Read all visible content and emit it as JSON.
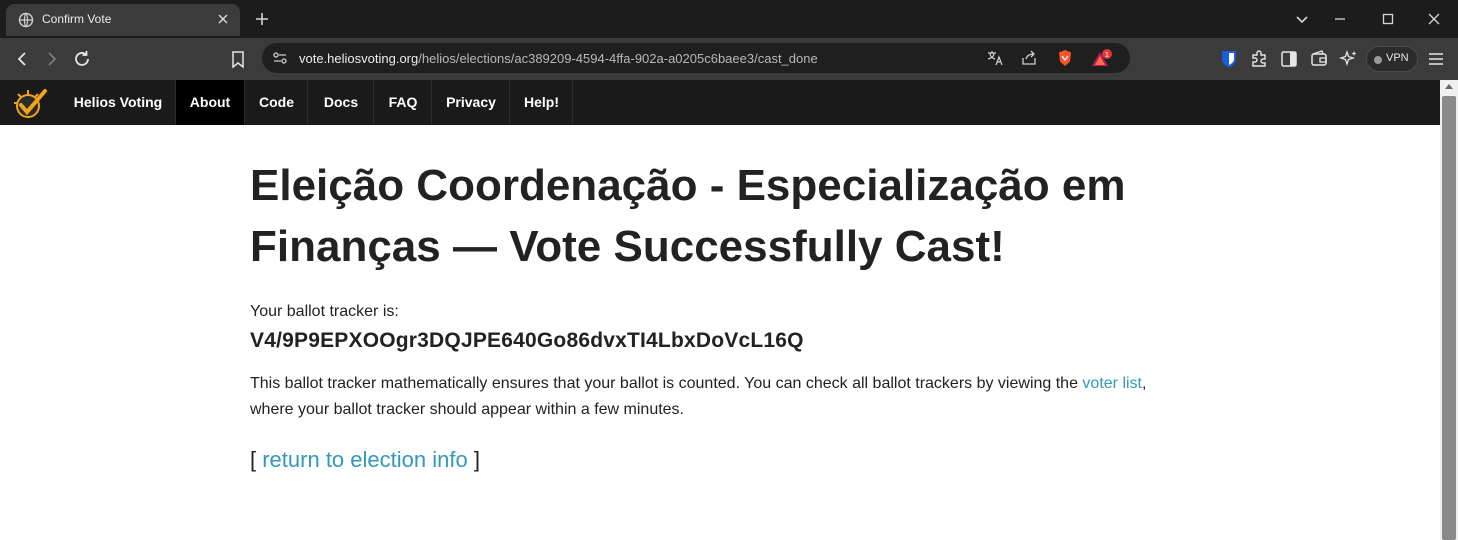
{
  "browser": {
    "tab_title": "Confirm Vote",
    "url_host": "vote.heliosvoting.org",
    "url_path": "/helios/elections/ac389209-4594-4ffa-902a-a0205c6baee3/cast_done",
    "shield_badge_count": "1",
    "vpn_label": "VPN"
  },
  "nav": {
    "brand": "Helios Voting",
    "items": [
      "About",
      "Code",
      "Docs",
      "FAQ",
      "Privacy",
      "Help!"
    ],
    "active": "About"
  },
  "page": {
    "title_line1": "Eleição Coordenação - Especialização em",
    "title_line2": "Finanças — Vote Successfully Cast!",
    "tracker_label": "Your ballot tracker is:",
    "tracker_value": "V4/9P9EPXOOgr3DQJPE640Go86dvxTI4LbxDoVcL16Q",
    "explain_before": "This ballot tracker mathematically ensures that your ballot is counted. You can check all ballot trackers by viewing the ",
    "voter_list_link": "voter list",
    "explain_after": ", where your ballot tracker should appear within a few minutes.",
    "return_open": "[ ",
    "return_link": "return to election info",
    "return_close": " ]"
  },
  "colors": {
    "link": "#3399bb",
    "nav_bg": "#1a1a1a",
    "brave_orange": "#fb542b"
  }
}
